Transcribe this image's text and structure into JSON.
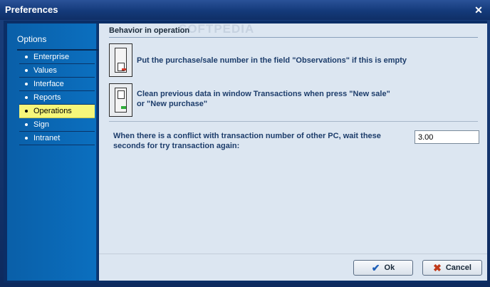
{
  "window": {
    "title": "Preferences",
    "close_glyph": "✕"
  },
  "sidebar": {
    "header": "Options",
    "items": [
      {
        "label": "Enterprise",
        "active": false
      },
      {
        "label": "Values",
        "active": false
      },
      {
        "label": "Interface",
        "active": false
      },
      {
        "label": "Reports",
        "active": false
      },
      {
        "label": "Operations",
        "active": true
      },
      {
        "label": "Sign",
        "active": false
      },
      {
        "label": "Intranet",
        "active": false
      }
    ]
  },
  "content": {
    "section_title": "Behavior in operation",
    "watermark": "SOFTPEDIA",
    "options": [
      {
        "text": "Put the purchase/sale number in the field \"Observations\" if this is empty",
        "state": "off",
        "led_color": "#d33a2a"
      },
      {
        "text": "Clean previous data in window Transactions when press \"New sale\" or \"New purchase\"",
        "state": "on",
        "led_color": "#2fae3a"
      }
    ],
    "conflict_label": "When there is a conflict with transaction number of other PC, wait these seconds for try transaction again:",
    "conflict_seconds": "3.00"
  },
  "buttons": {
    "ok_label": "Ok",
    "ok_icon": "check-icon",
    "cancel_label": "Cancel",
    "cancel_icon": "cross-icon"
  },
  "colors": {
    "accent": "#0b6fbf",
    "active_item": "#f6f67a",
    "label_text": "#1d3d6b"
  }
}
